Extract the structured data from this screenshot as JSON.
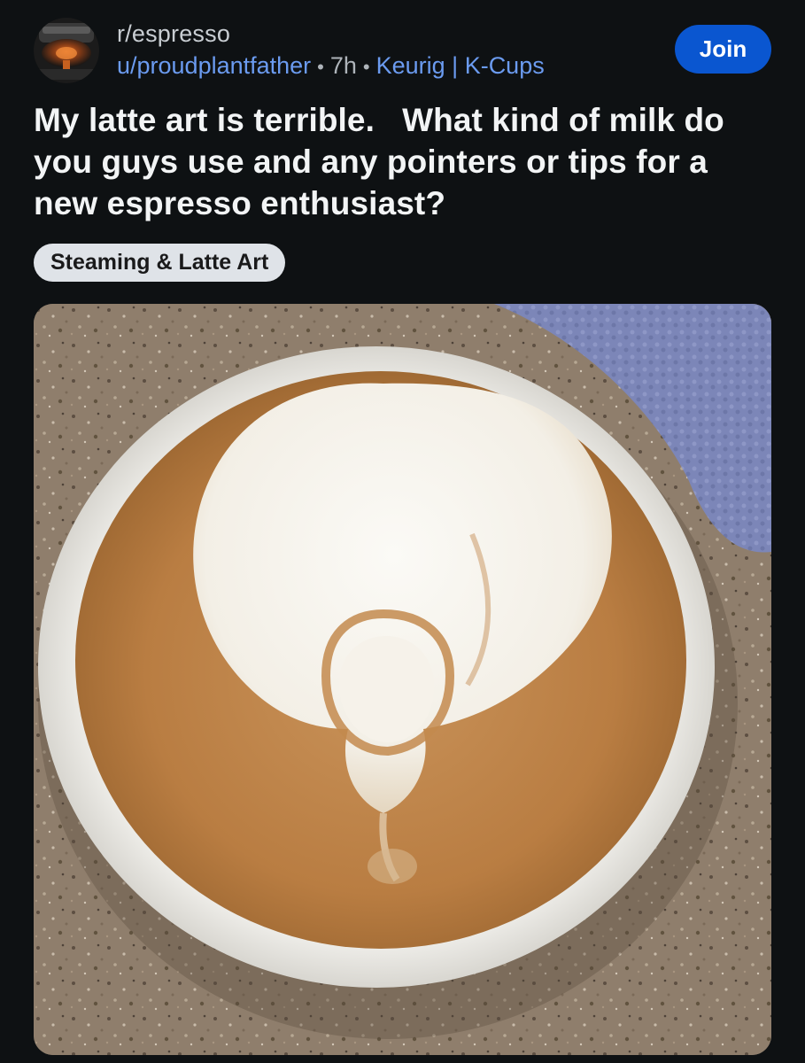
{
  "post": {
    "subreddit": "r/espresso",
    "author": "u/proudplantfather",
    "separator": "•",
    "age": "7h",
    "user_flair": "Keurig | K-Cups",
    "join_label": "Join",
    "title": "My latte art is terrible.   What kind of milk do you guys use and any pointers or tips for a new espresso enthusiast?",
    "post_flair": "Steaming & Latte Art"
  },
  "colors": {
    "background": "#0e1113",
    "join_button": "#0a56d0",
    "username_link": "#6b9bf0",
    "flair_chip": "#dfe3e8"
  },
  "media": {
    "type": "photo",
    "subject": "latte in white cup on granite counter with blue towel"
  }
}
